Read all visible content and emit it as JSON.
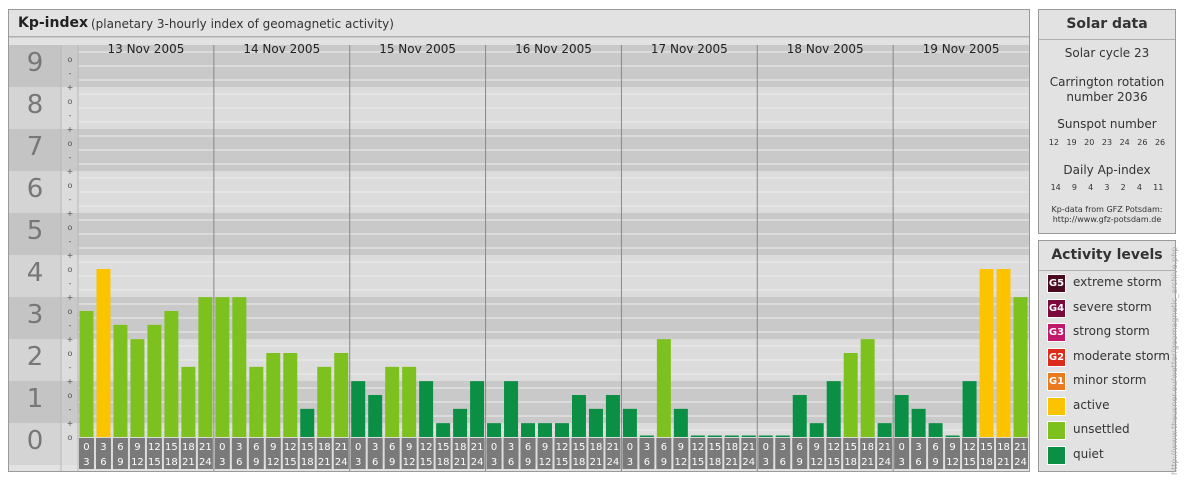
{
  "chart_data": {
    "type": "bar",
    "title": "Kp-index",
    "subtitle": "(planetary 3-hourly index of geomagnetic activity)",
    "days": [
      "13 Nov 2005",
      "14 Nov 2005",
      "15 Nov 2005",
      "16 Nov 2005",
      "17 Nov 2005",
      "18 Nov 2005",
      "19 Nov 2005"
    ],
    "interval_starts": [
      "0",
      "3",
      "6",
      "9",
      "12",
      "15",
      "18",
      "21"
    ],
    "interval_ends": [
      "3",
      "6",
      "9",
      "12",
      "15",
      "18",
      "21",
      "24"
    ],
    "y_ticks": [
      "0",
      "1",
      "2",
      "3",
      "4",
      "5",
      "6",
      "7",
      "8",
      "9"
    ],
    "thirds_labels": [
      "o",
      "+",
      "-"
    ],
    "ylim": [
      0,
      9
    ],
    "values": [
      3.0,
      4.0,
      2.67,
      2.33,
      2.67,
      3.0,
      1.67,
      3.33,
      3.33,
      3.33,
      1.67,
      2.0,
      2.0,
      0.67,
      1.67,
      2.0,
      1.33,
      1.0,
      1.67,
      1.67,
      1.33,
      0.33,
      0.67,
      1.33,
      0.33,
      1.33,
      0.33,
      0.33,
      0.33,
      1.0,
      0.67,
      1.0,
      0.67,
      0.0,
      2.33,
      0.67,
      0.0,
      0.0,
      0.0,
      0.0,
      0.0,
      0.0,
      1.0,
      0.33,
      1.33,
      2.0,
      2.33,
      0.33,
      1.0,
      0.67,
      0.33,
      0.0,
      1.33,
      4.0,
      4.0,
      3.33
    ],
    "level_colors": {
      "quiet": "#0a8f44",
      "unsettled": "#7dc11f",
      "active": "#fcc400"
    }
  },
  "solar": {
    "title": "Solar data",
    "cycle": "Solar cycle 23",
    "carrington_line1": "Carrington rotation",
    "carrington_line2": "number 2036",
    "sunspot_label": "Sunspot number",
    "sunspot_values": [
      "12",
      "19",
      "20",
      "23",
      "24",
      "26",
      "26"
    ],
    "ap_label": "Daily Ap-index",
    "ap_values": [
      "14",
      "9",
      "4",
      "3",
      "2",
      "4",
      "11"
    ],
    "source_line1": "Kp-data from GFZ Potsdam:",
    "source_line2": "http://www.gfz-potsdam.de"
  },
  "activity": {
    "title": "Activity levels",
    "items": [
      {
        "code": "G5",
        "label": "extreme storm",
        "color": "#4b0a22"
      },
      {
        "code": "G4",
        "label": "severe storm",
        "color": "#7a0a3c"
      },
      {
        "code": "G3",
        "label": "strong storm",
        "color": "#c0186a"
      },
      {
        "code": "G2",
        "label": "moderate storm",
        "color": "#dd2b1b"
      },
      {
        "code": "G1",
        "label": "minor storm",
        "color": "#eb7a1e"
      },
      {
        "code": "",
        "label": "active",
        "color": "#fcc400"
      },
      {
        "code": "",
        "label": "unsettled",
        "color": "#7dc11f"
      },
      {
        "code": "",
        "label": "quiet",
        "color": "#0a8f44"
      }
    ]
  },
  "credit": "http://www.theusner.eu/wetter/geomagnetic_archive.php"
}
